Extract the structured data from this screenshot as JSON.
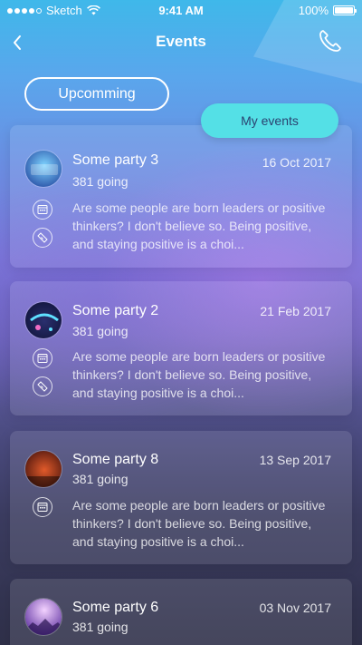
{
  "status_bar": {
    "carrier": "Sketch",
    "time": "9:41 AM",
    "battery": "100%",
    "icons": [
      "signal-dots-icon",
      "wifi-icon",
      "battery-icon"
    ]
  },
  "nav": {
    "title": "Events",
    "back_icon": "chevron-left-icon",
    "action_icon": "phone-icon"
  },
  "tabs": [
    {
      "label": "Upcomming",
      "active": false
    },
    {
      "label": "My events",
      "active": true
    }
  ],
  "events": [
    {
      "title": "Some party 3",
      "date": "16 Oct 2017",
      "going": "381 going",
      "description": "Are some people are born leaders or positive thinkers? I don't believe so. Being positive, and staying positive is a choi...",
      "icons": [
        "calendar-icon",
        "ticket-icon"
      ]
    },
    {
      "title": "Some party 2",
      "date": "21 Feb 2017",
      "going": "381 going",
      "description": "Are some people are born leaders or positive thinkers? I don't believe so. Being positive, and staying positive is a choi...",
      "icons": [
        "calendar-icon",
        "ticket-icon"
      ]
    },
    {
      "title": "Some party 8",
      "date": "13 Sep 2017",
      "going": "381 going",
      "description": "Are some people are born leaders or positive thinkers? I don't believe so. Being positive, and staying positive is a choi...",
      "icons": [
        "calendar-icon"
      ]
    },
    {
      "title": "Some party 6",
      "date": "03 Nov 2017",
      "going": "381 going",
      "description": "",
      "icons": []
    }
  ],
  "colors": {
    "accent": "#54e0e6",
    "accent_text": "#2b4270",
    "gradient_top": "#3fb8ea",
    "gradient_bottom": "#2f3049"
  }
}
